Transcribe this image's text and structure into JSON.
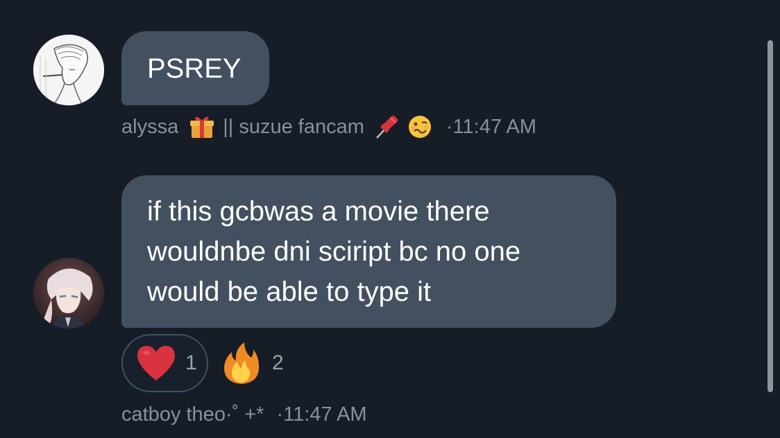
{
  "messages": [
    {
      "text": "PSREY",
      "author": "alyssa",
      "author_suffix": "|| suzue fancam",
      "author_emojis": [
        "gift-icon",
        "pushpin-icon",
        "woozy-face-icon"
      ],
      "time": "11:47 AM",
      "separator": "·"
    },
    {
      "text": "if this gcbwas a movie there wouldnbe dni sciript bc no one would be able to type it",
      "author": "catboy theo·˚ +*",
      "time": "11:47 AM",
      "separator": "·",
      "reactions": [
        {
          "icon": "heart-icon",
          "count": "1",
          "selected": true
        },
        {
          "icon": "fire-icon",
          "count": "2",
          "selected": false
        }
      ]
    }
  ],
  "colors": {
    "background": "#171d27",
    "bubble": "#435060",
    "meta_text": "#8791a0",
    "heart": "#d9333f",
    "reaction_border": "#3f5266"
  }
}
